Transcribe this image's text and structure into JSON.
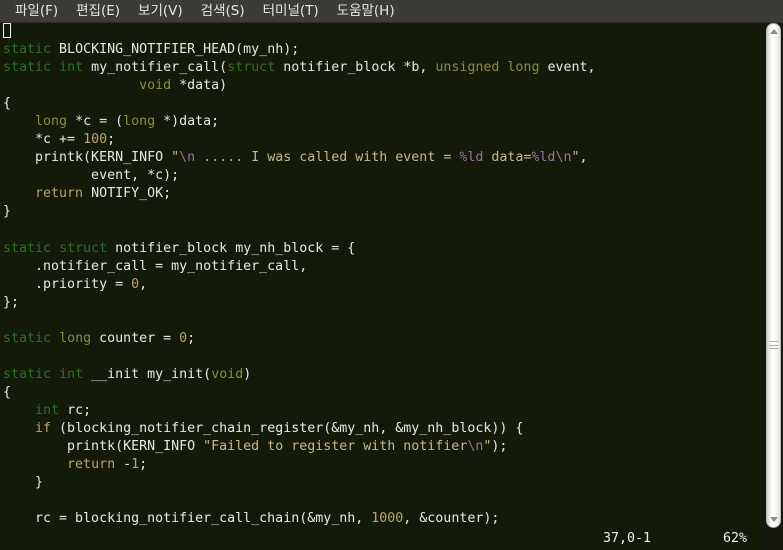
{
  "window": {
    "background": "#141a08",
    "menubar_background": "#3c3b37"
  },
  "menubar": {
    "items": [
      {
        "label": "파일(F)",
        "name": "menu-file"
      },
      {
        "label": "편집(E)",
        "name": "menu-edit"
      },
      {
        "label": "보기(V)",
        "name": "menu-view"
      },
      {
        "label": "검색(S)",
        "name": "menu-search"
      },
      {
        "label": "터미널(T)",
        "name": "menu-terminal"
      },
      {
        "label": "도움말(H)",
        "name": "menu-help"
      }
    ]
  },
  "editor": {
    "cursor_line": 1,
    "lines": [
      {
        "segments": [
          {
            "t": "",
            "c": "plain"
          }
        ]
      },
      {
        "segments": [
          {
            "t": "static",
            "c": "type"
          },
          {
            "t": " BLOCKING_NOTIFIER_HEAD(my_nh);",
            "c": "plain"
          }
        ]
      },
      {
        "segments": [
          {
            "t": "static",
            "c": "type"
          },
          {
            "t": " ",
            "c": "plain"
          },
          {
            "t": "int",
            "c": "type"
          },
          {
            "t": " my_notifier_call(",
            "c": "plain"
          },
          {
            "t": "struct",
            "c": "type"
          },
          {
            "t": " notifier_block *b, ",
            "c": "plain"
          },
          {
            "t": "unsigned",
            "c": "type2"
          },
          {
            "t": " ",
            "c": "plain"
          },
          {
            "t": "long",
            "c": "type2"
          },
          {
            "t": " event,",
            "c": "plain"
          }
        ]
      },
      {
        "segments": [
          {
            "t": "                 ",
            "c": "plain"
          },
          {
            "t": "void",
            "c": "type2"
          },
          {
            "t": " *data)",
            "c": "plain"
          }
        ]
      },
      {
        "segments": [
          {
            "t": "{",
            "c": "plain"
          }
        ]
      },
      {
        "segments": [
          {
            "t": "    ",
            "c": "plain"
          },
          {
            "t": "long",
            "c": "type2"
          },
          {
            "t": " *c = (",
            "c": "plain"
          },
          {
            "t": "long",
            "c": "type2"
          },
          {
            "t": " *)data;",
            "c": "plain"
          }
        ]
      },
      {
        "segments": [
          {
            "t": "    *c += ",
            "c": "plain"
          },
          {
            "t": "100",
            "c": "num"
          },
          {
            "t": ";",
            "c": "plain"
          }
        ]
      },
      {
        "segments": [
          {
            "t": "    printk(KERN_INFO ",
            "c": "plain"
          },
          {
            "t": "\"",
            "c": "str"
          },
          {
            "t": "\\n",
            "c": "spec"
          },
          {
            "t": " ..... I was called with event = ",
            "c": "str"
          },
          {
            "t": "%ld",
            "c": "spec"
          },
          {
            "t": " data=",
            "c": "str"
          },
          {
            "t": "%ld",
            "c": "spec"
          },
          {
            "t": "\\n",
            "c": "spec"
          },
          {
            "t": "\"",
            "c": "str"
          },
          {
            "t": ",",
            "c": "plain"
          }
        ]
      },
      {
        "segments": [
          {
            "t": "           event, *c);",
            "c": "plain"
          }
        ]
      },
      {
        "segments": [
          {
            "t": "    ",
            "c": "plain"
          },
          {
            "t": "return",
            "c": "stmt"
          },
          {
            "t": " NOTIFY_OK;",
            "c": "plain"
          }
        ]
      },
      {
        "segments": [
          {
            "t": "}",
            "c": "plain"
          }
        ]
      },
      {
        "segments": [
          {
            "t": "",
            "c": "plain"
          }
        ]
      },
      {
        "segments": [
          {
            "t": "static",
            "c": "type"
          },
          {
            "t": " ",
            "c": "plain"
          },
          {
            "t": "struct",
            "c": "type"
          },
          {
            "t": " notifier_block my_nh_block = {",
            "c": "plain"
          }
        ]
      },
      {
        "segments": [
          {
            "t": "    .notifier_call = my_notifier_call,",
            "c": "plain"
          }
        ]
      },
      {
        "segments": [
          {
            "t": "    .priority = ",
            "c": "plain"
          },
          {
            "t": "0",
            "c": "num"
          },
          {
            "t": ",",
            "c": "plain"
          }
        ]
      },
      {
        "segments": [
          {
            "t": "};",
            "c": "plain"
          }
        ]
      },
      {
        "segments": [
          {
            "t": "",
            "c": "plain"
          }
        ]
      },
      {
        "segments": [
          {
            "t": "static",
            "c": "type"
          },
          {
            "t": " ",
            "c": "plain"
          },
          {
            "t": "long",
            "c": "type2"
          },
          {
            "t": " counter = ",
            "c": "plain"
          },
          {
            "t": "0",
            "c": "num"
          },
          {
            "t": ";",
            "c": "plain"
          }
        ]
      },
      {
        "segments": [
          {
            "t": "",
            "c": "plain"
          }
        ]
      },
      {
        "segments": [
          {
            "t": "static",
            "c": "type"
          },
          {
            "t": " ",
            "c": "plain"
          },
          {
            "t": "int",
            "c": "type"
          },
          {
            "t": " __init my_init(",
            "c": "plain"
          },
          {
            "t": "void",
            "c": "type2"
          },
          {
            "t": ")",
            "c": "plain"
          }
        ]
      },
      {
        "segments": [
          {
            "t": "{",
            "c": "plain"
          }
        ]
      },
      {
        "segments": [
          {
            "t": "    ",
            "c": "plain"
          },
          {
            "t": "int",
            "c": "type"
          },
          {
            "t": " rc;",
            "c": "plain"
          }
        ]
      },
      {
        "segments": [
          {
            "t": "    ",
            "c": "plain"
          },
          {
            "t": "if",
            "c": "stmt"
          },
          {
            "t": " (blocking_notifier_chain_register(&my_nh, &my_nh_block)) {",
            "c": "plain"
          }
        ]
      },
      {
        "segments": [
          {
            "t": "        printk(KERN_INFO ",
            "c": "plain"
          },
          {
            "t": "\"Failed to register with notifier",
            "c": "str"
          },
          {
            "t": "\\n",
            "c": "spec"
          },
          {
            "t": "\"",
            "c": "str"
          },
          {
            "t": ");",
            "c": "plain"
          }
        ]
      },
      {
        "segments": [
          {
            "t": "        ",
            "c": "plain"
          },
          {
            "t": "return",
            "c": "stmt"
          },
          {
            "t": " -",
            "c": "plain"
          },
          {
            "t": "1",
            "c": "num"
          },
          {
            "t": ";",
            "c": "plain"
          }
        ]
      },
      {
        "segments": [
          {
            "t": "    }",
            "c": "plain"
          }
        ]
      },
      {
        "segments": [
          {
            "t": "",
            "c": "plain"
          }
        ]
      },
      {
        "segments": [
          {
            "t": "    rc = blocking_notifier_call_chain(&my_nh, ",
            "c": "plain"
          },
          {
            "t": "1000",
            "c": "num"
          },
          {
            "t": ", &counter);",
            "c": "plain"
          }
        ]
      }
    ]
  },
  "statusbar": {
    "position": "37,0-1",
    "percent": "62%"
  },
  "scrollbar": {
    "up_arrow": "triangle-up-icon",
    "down_arrow": "triangle-down-icon"
  }
}
